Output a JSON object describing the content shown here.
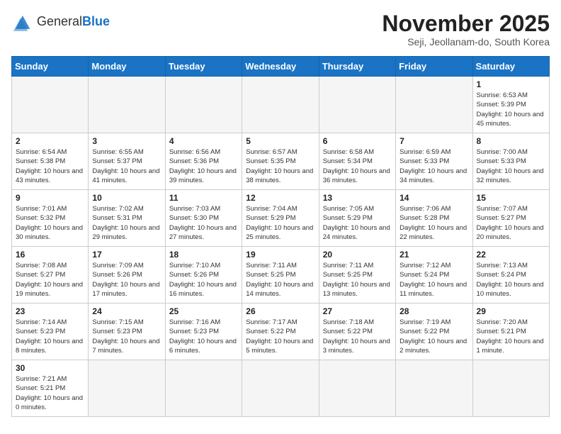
{
  "header": {
    "logo_text_regular": "General",
    "logo_text_blue": "Blue",
    "title": "November 2025",
    "subtitle": "Seji, Jeollanam-do, South Korea"
  },
  "weekdays": [
    "Sunday",
    "Monday",
    "Tuesday",
    "Wednesday",
    "Thursday",
    "Friday",
    "Saturday"
  ],
  "weeks": [
    [
      {
        "day": "",
        "info": ""
      },
      {
        "day": "",
        "info": ""
      },
      {
        "day": "",
        "info": ""
      },
      {
        "day": "",
        "info": ""
      },
      {
        "day": "",
        "info": ""
      },
      {
        "day": "",
        "info": ""
      },
      {
        "day": "1",
        "info": "Sunrise: 6:53 AM\nSunset: 5:39 PM\nDaylight: 10 hours and 45 minutes."
      }
    ],
    [
      {
        "day": "2",
        "info": "Sunrise: 6:54 AM\nSunset: 5:38 PM\nDaylight: 10 hours and 43 minutes."
      },
      {
        "day": "3",
        "info": "Sunrise: 6:55 AM\nSunset: 5:37 PM\nDaylight: 10 hours and 41 minutes."
      },
      {
        "day": "4",
        "info": "Sunrise: 6:56 AM\nSunset: 5:36 PM\nDaylight: 10 hours and 39 minutes."
      },
      {
        "day": "5",
        "info": "Sunrise: 6:57 AM\nSunset: 5:35 PM\nDaylight: 10 hours and 38 minutes."
      },
      {
        "day": "6",
        "info": "Sunrise: 6:58 AM\nSunset: 5:34 PM\nDaylight: 10 hours and 36 minutes."
      },
      {
        "day": "7",
        "info": "Sunrise: 6:59 AM\nSunset: 5:33 PM\nDaylight: 10 hours and 34 minutes."
      },
      {
        "day": "8",
        "info": "Sunrise: 7:00 AM\nSunset: 5:33 PM\nDaylight: 10 hours and 32 minutes."
      }
    ],
    [
      {
        "day": "9",
        "info": "Sunrise: 7:01 AM\nSunset: 5:32 PM\nDaylight: 10 hours and 30 minutes."
      },
      {
        "day": "10",
        "info": "Sunrise: 7:02 AM\nSunset: 5:31 PM\nDaylight: 10 hours and 29 minutes."
      },
      {
        "day": "11",
        "info": "Sunrise: 7:03 AM\nSunset: 5:30 PM\nDaylight: 10 hours and 27 minutes."
      },
      {
        "day": "12",
        "info": "Sunrise: 7:04 AM\nSunset: 5:29 PM\nDaylight: 10 hours and 25 minutes."
      },
      {
        "day": "13",
        "info": "Sunrise: 7:05 AM\nSunset: 5:29 PM\nDaylight: 10 hours and 24 minutes."
      },
      {
        "day": "14",
        "info": "Sunrise: 7:06 AM\nSunset: 5:28 PM\nDaylight: 10 hours and 22 minutes."
      },
      {
        "day": "15",
        "info": "Sunrise: 7:07 AM\nSunset: 5:27 PM\nDaylight: 10 hours and 20 minutes."
      }
    ],
    [
      {
        "day": "16",
        "info": "Sunrise: 7:08 AM\nSunset: 5:27 PM\nDaylight: 10 hours and 19 minutes."
      },
      {
        "day": "17",
        "info": "Sunrise: 7:09 AM\nSunset: 5:26 PM\nDaylight: 10 hours and 17 minutes."
      },
      {
        "day": "18",
        "info": "Sunrise: 7:10 AM\nSunset: 5:26 PM\nDaylight: 10 hours and 16 minutes."
      },
      {
        "day": "19",
        "info": "Sunrise: 7:11 AM\nSunset: 5:25 PM\nDaylight: 10 hours and 14 minutes."
      },
      {
        "day": "20",
        "info": "Sunrise: 7:11 AM\nSunset: 5:25 PM\nDaylight: 10 hours and 13 minutes."
      },
      {
        "day": "21",
        "info": "Sunrise: 7:12 AM\nSunset: 5:24 PM\nDaylight: 10 hours and 11 minutes."
      },
      {
        "day": "22",
        "info": "Sunrise: 7:13 AM\nSunset: 5:24 PM\nDaylight: 10 hours and 10 minutes."
      }
    ],
    [
      {
        "day": "23",
        "info": "Sunrise: 7:14 AM\nSunset: 5:23 PM\nDaylight: 10 hours and 8 minutes."
      },
      {
        "day": "24",
        "info": "Sunrise: 7:15 AM\nSunset: 5:23 PM\nDaylight: 10 hours and 7 minutes."
      },
      {
        "day": "25",
        "info": "Sunrise: 7:16 AM\nSunset: 5:23 PM\nDaylight: 10 hours and 6 minutes."
      },
      {
        "day": "26",
        "info": "Sunrise: 7:17 AM\nSunset: 5:22 PM\nDaylight: 10 hours and 5 minutes."
      },
      {
        "day": "27",
        "info": "Sunrise: 7:18 AM\nSunset: 5:22 PM\nDaylight: 10 hours and 3 minutes."
      },
      {
        "day": "28",
        "info": "Sunrise: 7:19 AM\nSunset: 5:22 PM\nDaylight: 10 hours and 2 minutes."
      },
      {
        "day": "29",
        "info": "Sunrise: 7:20 AM\nSunset: 5:21 PM\nDaylight: 10 hours and 1 minute."
      }
    ],
    [
      {
        "day": "30",
        "info": "Sunrise: 7:21 AM\nSunset: 5:21 PM\nDaylight: 10 hours and 0 minutes."
      },
      {
        "day": "",
        "info": ""
      },
      {
        "day": "",
        "info": ""
      },
      {
        "day": "",
        "info": ""
      },
      {
        "day": "",
        "info": ""
      },
      {
        "day": "",
        "info": ""
      },
      {
        "day": "",
        "info": ""
      }
    ]
  ]
}
